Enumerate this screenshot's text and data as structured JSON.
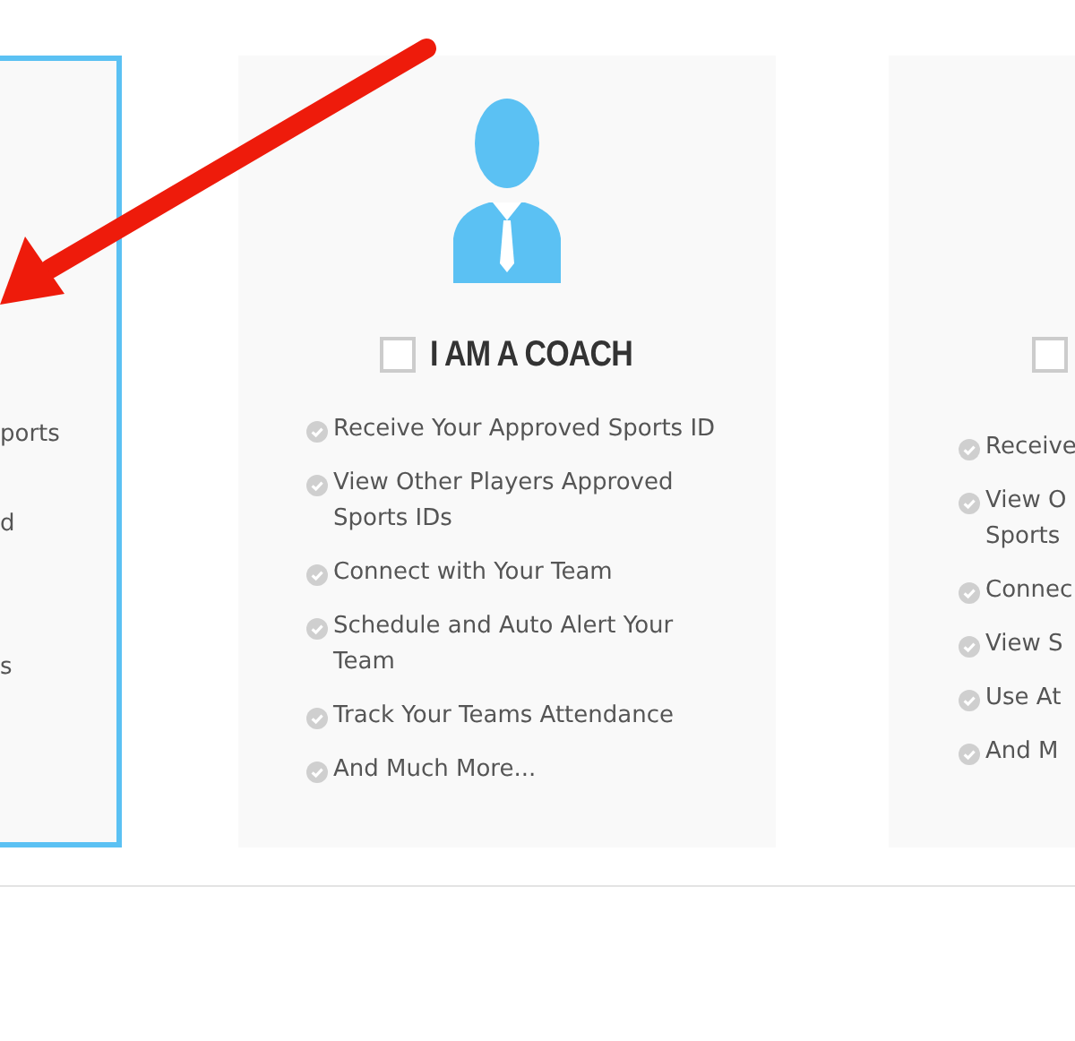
{
  "cards": [
    {
      "selected": true,
      "items": [
        {
          "lines": [
            "ports"
          ]
        },
        {
          "lines": [
            "d"
          ]
        },
        {
          "lines": [
            "s"
          ]
        }
      ]
    },
    {
      "selected": false,
      "checkbox": {
        "checked": false
      },
      "title": "I AM A COACH",
      "items": [
        {
          "lines": [
            "Receive Your Approved Sports ID"
          ]
        },
        {
          "lines": [
            "View Other Players Approved",
            "Sports IDs"
          ]
        },
        {
          "lines": [
            "Connect with Your Team"
          ]
        },
        {
          "lines": [
            "Schedule and Auto Alert Your",
            "Team"
          ]
        },
        {
          "lines": [
            "Track Your Teams Attendance"
          ]
        },
        {
          "lines": [
            "And Much More..."
          ]
        }
      ]
    },
    {
      "selected": false,
      "checkbox": {
        "checked": false
      },
      "items": [
        {
          "lines": [
            "Receive"
          ]
        },
        {
          "lines": [
            "View O",
            "Sports"
          ]
        },
        {
          "lines": [
            "Connec"
          ]
        },
        {
          "lines": [
            "View S"
          ]
        },
        {
          "lines": [
            "Use At"
          ]
        },
        {
          "lines": [
            "And M"
          ]
        }
      ]
    }
  ]
}
